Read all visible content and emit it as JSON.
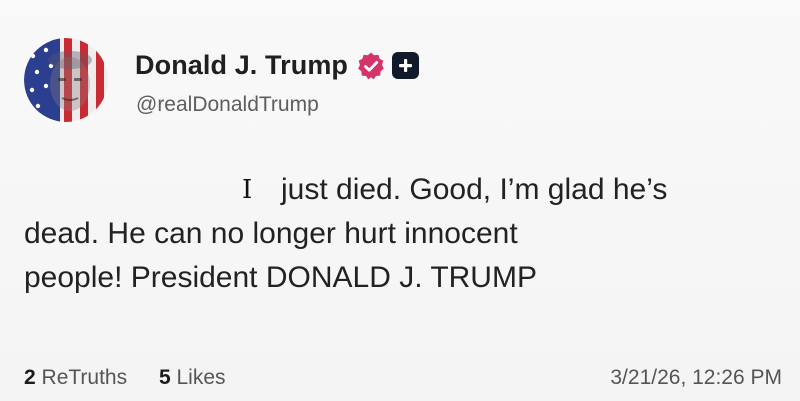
{
  "author": {
    "display_name": "Donald J. Trump",
    "handle": "@realDonaldTrump",
    "verified_icon": "verified-check-icon",
    "plus_icon": "plus-badge-icon",
    "accent_color": "#d6336c"
  },
  "post": {
    "cursor_glyph": "I",
    "line1": "just died. Good, I’m glad he’s",
    "line2": "dead. He can no longer hurt innocent",
    "line3": "people! President DONALD J. TRUMP"
  },
  "stats": {
    "retruths_count": "2",
    "retruths_label": "ReTruths",
    "likes_count": "5",
    "likes_label": "Likes"
  },
  "timestamp": "3/21/26, 12:26 PM"
}
